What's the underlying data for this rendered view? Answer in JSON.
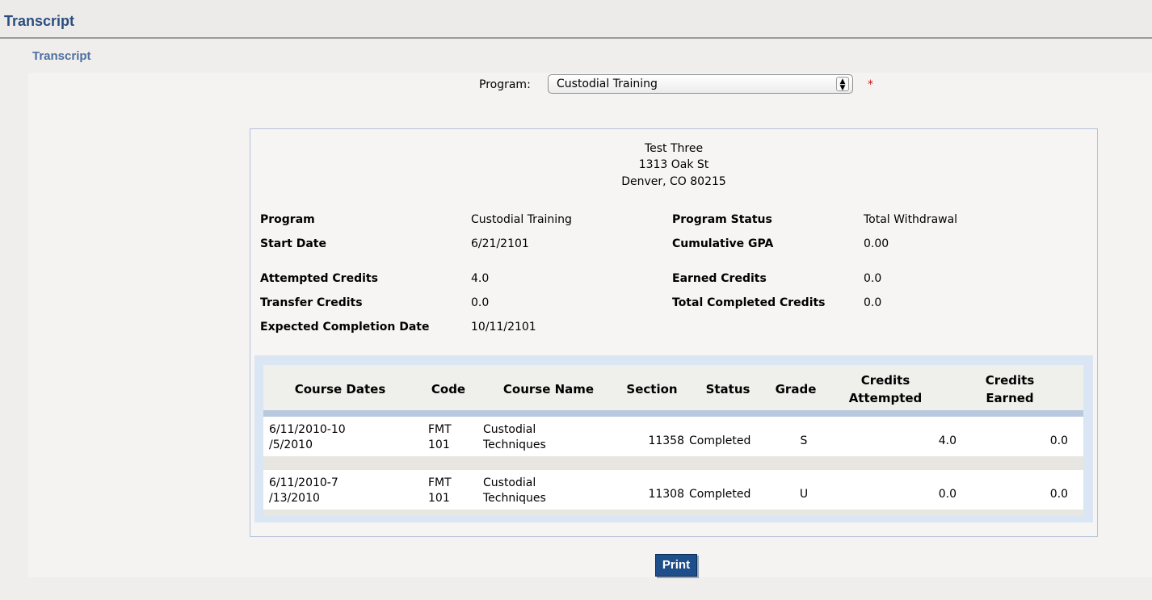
{
  "header": {
    "title": "Transcript"
  },
  "section": {
    "title": "Transcript"
  },
  "program_select": {
    "label": "Program:",
    "value": "Custodial Training",
    "required_marker": "*"
  },
  "student": {
    "name": "Test Three",
    "street": "1313 Oak St",
    "city_state_zip": "Denver, CO 80215"
  },
  "summary": {
    "program_label": "Program",
    "program_value": "Custodial Training",
    "status_label": "Program Status",
    "status_value": "Total Withdrawal",
    "start_label": "Start Date",
    "start_value": "6/21/2101",
    "gpa_label": "Cumulative GPA",
    "gpa_value": "0.00",
    "attempted_label": "Attempted Credits",
    "attempted_value": "4.0",
    "earned_label": "Earned Credits",
    "earned_value": "0.0",
    "transfer_label": "Transfer Credits",
    "transfer_value": "0.0",
    "completed_label": "Total Completed Credits",
    "completed_value": "0.0",
    "expected_label": "Expected Completion Date",
    "expected_value": "10/11/2101"
  },
  "table": {
    "headers": {
      "dates": "Course Dates",
      "code": "Code",
      "name": "Course Name",
      "section": "Section",
      "status": "Status",
      "grade": "Grade",
      "attempted_1": "Credits",
      "attempted_2": "Attempted",
      "earned_1": "Credits",
      "earned_2": "Earned"
    },
    "rows": [
      {
        "dates_1": "6/11/2010-10",
        "dates_2": "/5/2010",
        "code_1": "FMT",
        "code_2": "101",
        "name_1": "Custodial",
        "name_2": "Techniques",
        "section": "11358",
        "status": "Completed",
        "grade": "S",
        "attempted": "4.0",
        "earned": "0.0"
      },
      {
        "dates_1": "6/11/2010-7",
        "dates_2": "/13/2010",
        "code_1": "FMT",
        "code_2": "101",
        "name_1": "Custodial",
        "name_2": "Techniques",
        "section": "11308",
        "status": "Completed",
        "grade": "U",
        "attempted": "0.0",
        "earned": "0.0"
      }
    ]
  },
  "print_button": {
    "label": "Print"
  }
}
